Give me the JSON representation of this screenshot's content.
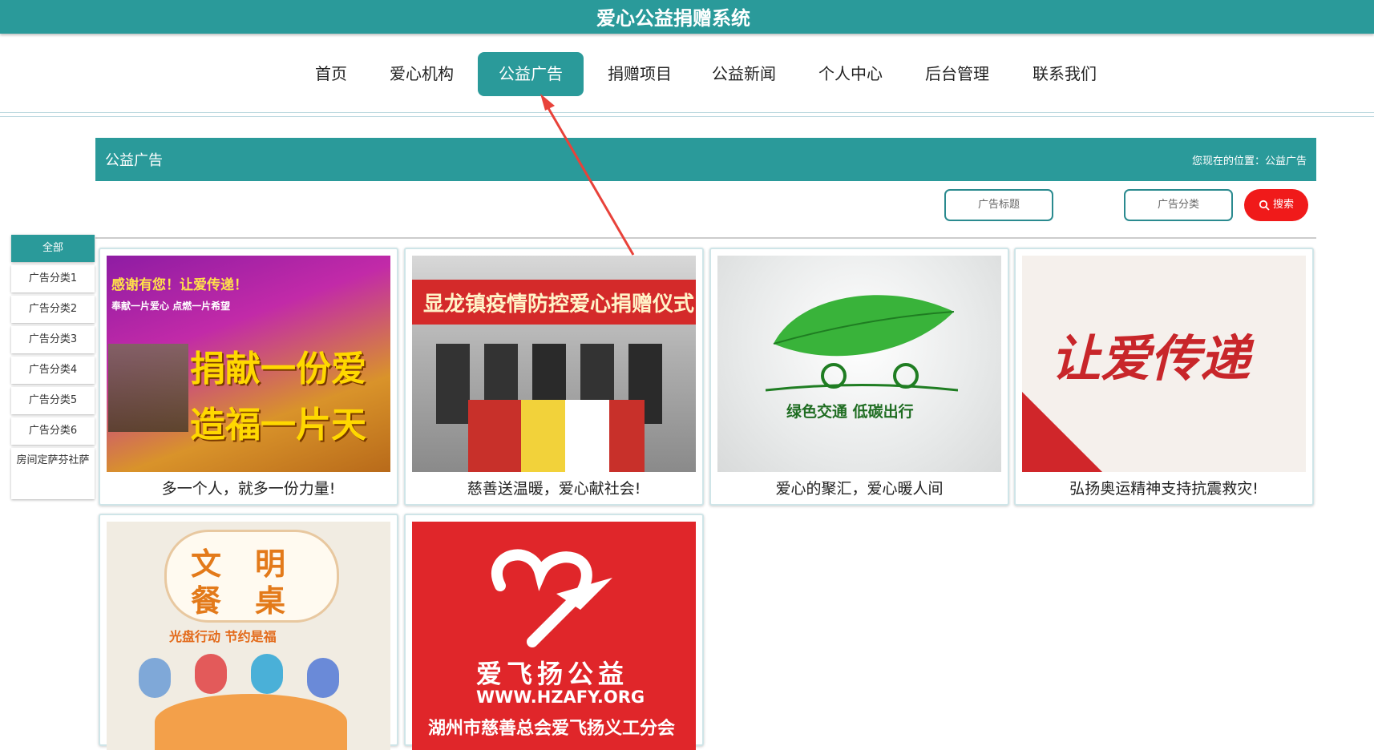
{
  "header": {
    "site_title": "爱心公益捐赠系统"
  },
  "nav": {
    "items": [
      "首页",
      "爱心机构",
      "公益广告",
      "捐赠项目",
      "公益新闻",
      "个人中心",
      "后台管理",
      "联系我们"
    ],
    "active_index": 2
  },
  "section": {
    "title": "公益广告",
    "breadcrumb": "您现在的位置：公益广告"
  },
  "filters": {
    "title_placeholder": "广告标题",
    "category_placeholder": "广告分类",
    "search_label": "搜索"
  },
  "sidebar": {
    "items": [
      "全部",
      "广告分类1",
      "广告分类2",
      "广告分类3",
      "广告分类4",
      "广告分类5",
      "广告分类6",
      "房间定萨芬社萨"
    ],
    "active_index": 0
  },
  "cards": [
    {
      "caption": "多一个人，就多一份力量!",
      "poster_text": [
        "感谢有您！让爱传递！",
        "奉献一片爱心 点燃一片希望",
        "捐献一份爱",
        "造福一片天"
      ]
    },
    {
      "caption": "慈善送温暖，爱心献社会!",
      "poster_text": [
        "显龙镇疫情防控爱心捐赠仪式"
      ]
    },
    {
      "caption": "爱心的聚汇，爱心暖人间",
      "poster_text": [
        "绿色交通 低碳出行"
      ]
    },
    {
      "caption": "弘扬奥运精神支持抗震救灾!",
      "poster_text": [
        "让爱传递"
      ]
    },
    {
      "caption": "",
      "poster_text": [
        "文",
        "明",
        "餐",
        "桌",
        "光盘行动 节约是福"
      ]
    },
    {
      "caption": "",
      "poster_text": [
        "爱飞扬公益",
        "WWW.HZAFY.ORG",
        "湖州市慈善总会爱飞扬义工分会"
      ]
    }
  ],
  "colors": {
    "primary": "#2a9a9a",
    "search": "#f01a1a",
    "annotation_arrow": "#e8423a"
  }
}
